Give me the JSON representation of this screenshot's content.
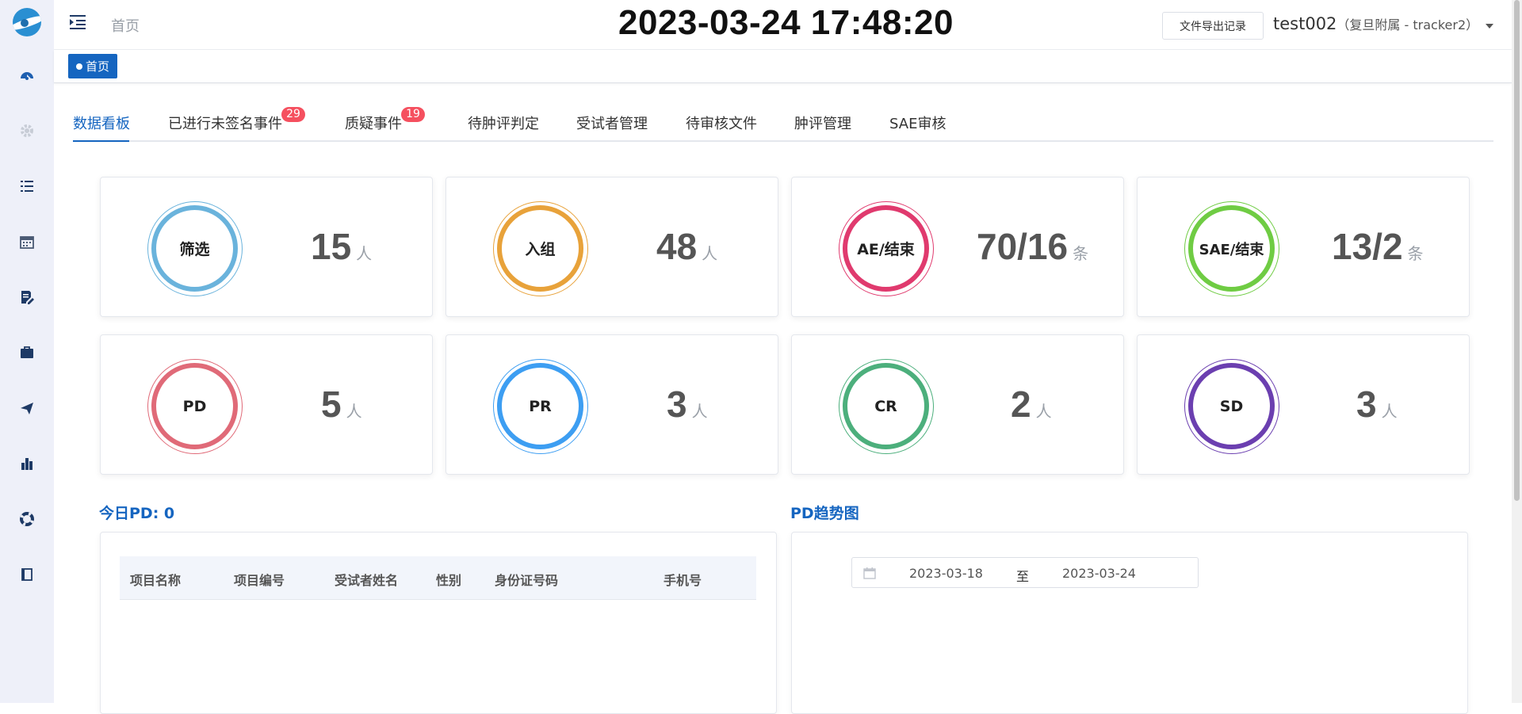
{
  "header": {
    "breadcrumb_home": "首页",
    "clock": "2023-03-24 17:48:20",
    "export_button": "文件导出记录",
    "user_name": "test002",
    "user_sub": "（复旦附属 - tracker2）"
  },
  "tagsbar": {
    "home_tag": "首页"
  },
  "sidebar": {
    "icons": [
      "dashboard-icon",
      "gear-icon",
      "list-icon",
      "calendar-icon",
      "edit-document-icon",
      "briefcase-icon",
      "send-icon",
      "bar-chart-icon",
      "lifebuoy-icon",
      "book-icon"
    ]
  },
  "tabs": [
    {
      "label": "数据看板",
      "active": true
    },
    {
      "label": "已进行未签名事件",
      "badge": "29"
    },
    {
      "label": "质疑事件",
      "badge": "19"
    },
    {
      "label": "待肿评判定"
    },
    {
      "label": "受试者管理"
    },
    {
      "label": "待审核文件"
    },
    {
      "label": "肿评管理"
    },
    {
      "label": "SAE审核"
    }
  ],
  "stats": [
    {
      "label": "筛选",
      "value": "15",
      "unit": "人",
      "color": "#6ab3dc"
    },
    {
      "label": "入组",
      "value": "48",
      "unit": "人",
      "color": "#e8a23a"
    },
    {
      "label": "AE/结束",
      "value": "70/16",
      "unit": "条",
      "color": "#e03a6e"
    },
    {
      "label": "SAE/结束",
      "value": "13/2",
      "unit": "条",
      "color": "#6fcc43"
    },
    {
      "label": "PD",
      "value": "5",
      "unit": "人",
      "color": "#e06a78"
    },
    {
      "label": "PR",
      "value": "3",
      "unit": "人",
      "color": "#3d9ef2"
    },
    {
      "label": "CR",
      "value": "2",
      "unit": "人",
      "color": "#4caf7c"
    },
    {
      "label": "SD",
      "value": "3",
      "unit": "人",
      "color": "#6b3fb0"
    }
  ],
  "today_pd": {
    "title": "今日PD: 0",
    "columns": [
      "项目名称",
      "项目编号",
      "受试者姓名",
      "性别",
      "身份证号码",
      "手机号"
    ]
  },
  "pd_trend": {
    "title": "PD趋势图",
    "date_start": "2023-03-18",
    "date_separator": "至",
    "date_end": "2023-03-24"
  }
}
